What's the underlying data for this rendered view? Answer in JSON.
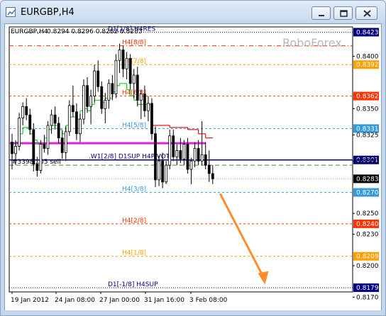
{
  "window": {
    "title": "EURGBP,H4",
    "controls": [
      "minimize-icon",
      "restore-icon",
      "close-icon"
    ]
  },
  "chart_data": {
    "type": "candlestick",
    "symbol_header": "EURGBP,H4",
    "ohlc_header": "0.8294 0.8296 0.8282 0.8283",
    "watermark": "RoboForex",
    "order_label": "#3398...05 sell",
    "ylim": [
      0.8175,
      0.8428
    ],
    "y_ticks": [
      "0.8400",
      "0.8350",
      "0.8325",
      "0.8300",
      "0.8250",
      "0.8230",
      "0.8200",
      "0.8170"
    ],
    "x_ticks": [
      "19 Jan 2012",
      "24 Jan 08:00",
      "27 Jan 00:00",
      "31 Jan 16:00",
      "3 Feb 08:00"
    ],
    "levels": [
      {
        "label": "D1[1/8] H4RES",
        "value": 0.8423,
        "price": "0.8423",
        "color": "#000080",
        "style": "dotted"
      },
      {
        "label": "H4[8/8]",
        "value": 0.841,
        "price": "",
        "color": "#ff2a00",
        "style": "dashdot"
      },
      {
        "label": "H4[7/8]",
        "value": 0.8392,
        "price": "0.8392",
        "color": "#ffa000",
        "style": "dashed"
      },
      {
        "label": "H4[6/8]",
        "value": 0.8362,
        "price": "0.8362",
        "color": "#ff3300",
        "style": "dashed"
      },
      {
        "label": "H4[5/8]",
        "value": 0.8331,
        "price": "0.8331",
        "color": "#3399dd",
        "style": "dashed"
      },
      {
        "label": ".W1[2/8] D1SUP H4PIVOT",
        "value": 0.8301,
        "price": "0.8301",
        "color": "#000080",
        "style": "solid"
      },
      {
        "label": "H4[3/8]",
        "value": 0.827,
        "price": "0.8270",
        "color": "#3399dd",
        "style": "dashed"
      },
      {
        "label": "H4[2/8]",
        "value": 0.824,
        "price": "0.8240",
        "color": "#ff3300",
        "style": "dashed"
      },
      {
        "label": "H4[1/8]",
        "value": 0.8209,
        "price": "0.8209",
        "color": "#ffa000",
        "style": "dashed"
      },
      {
        "label": "D1[-1/8] H4SUP",
        "value": 0.8179,
        "price": "0.8179",
        "color": "#000080",
        "style": "dotted"
      }
    ],
    "current_price": {
      "value": 0.8283,
      "price": "0.8283"
    },
    "order_line": {
      "value": 0.8296,
      "color": "#3a8a3a"
    },
    "magenta_line": {
      "value": 0.8317,
      "color": "#e020e0"
    },
    "candles": [
      [
        0.8318,
        0.8326,
        0.8292,
        0.8307
      ],
      [
        0.8307,
        0.832,
        0.8296,
        0.8314
      ],
      [
        0.8314,
        0.8346,
        0.831,
        0.8341
      ],
      [
        0.8341,
        0.8356,
        0.8334,
        0.8352
      ],
      [
        0.8352,
        0.836,
        0.8339,
        0.8344
      ],
      [
        0.8344,
        0.835,
        0.8325,
        0.833
      ],
      [
        0.833,
        0.8336,
        0.829,
        0.8297
      ],
      [
        0.8297,
        0.8304,
        0.8285,
        0.8291
      ],
      [
        0.8291,
        0.832,
        0.8288,
        0.8316
      ],
      [
        0.8316,
        0.8325,
        0.8308,
        0.8312
      ],
      [
        0.8312,
        0.8338,
        0.8306,
        0.8334
      ],
      [
        0.8334,
        0.8349,
        0.8326,
        0.8344
      ],
      [
        0.8344,
        0.8352,
        0.833,
        0.8336
      ],
      [
        0.8336,
        0.8342,
        0.8317,
        0.8322
      ],
      [
        0.8322,
        0.8329,
        0.8302,
        0.8308
      ],
      [
        0.8308,
        0.8333,
        0.83,
        0.8328
      ],
      [
        0.8328,
        0.8358,
        0.8324,
        0.8353
      ],
      [
        0.8353,
        0.8372,
        0.8342,
        0.8347
      ],
      [
        0.8347,
        0.8355,
        0.832,
        0.8326
      ],
      [
        0.8326,
        0.8345,
        0.8318,
        0.834
      ],
      [
        0.834,
        0.8378,
        0.8335,
        0.8372
      ],
      [
        0.8372,
        0.838,
        0.8346,
        0.8352
      ],
      [
        0.8352,
        0.8368,
        0.8335,
        0.8362
      ],
      [
        0.8362,
        0.8392,
        0.8356,
        0.8386
      ],
      [
        0.8386,
        0.8396,
        0.8366,
        0.8371
      ],
      [
        0.8371,
        0.8376,
        0.8345,
        0.835
      ],
      [
        0.835,
        0.8365,
        0.8336,
        0.8358
      ],
      [
        0.8358,
        0.8378,
        0.835,
        0.8374
      ],
      [
        0.8374,
        0.8382,
        0.8358,
        0.8364
      ],
      [
        0.8364,
        0.8402,
        0.836,
        0.8396
      ],
      [
        0.8396,
        0.8412,
        0.8384,
        0.8406
      ],
      [
        0.8406,
        0.841,
        0.838,
        0.8388
      ],
      [
        0.8388,
        0.8404,
        0.8378,
        0.8398
      ],
      [
        0.8398,
        0.8402,
        0.8368,
        0.8374
      ],
      [
        0.8374,
        0.8388,
        0.836,
        0.8382
      ],
      [
        0.8382,
        0.839,
        0.8352,
        0.8358
      ],
      [
        0.8358,
        0.8368,
        0.834,
        0.8364
      ],
      [
        0.8364,
        0.8372,
        0.8342,
        0.8348
      ],
      [
        0.8348,
        0.8362,
        0.8338,
        0.8355
      ],
      [
        0.8355,
        0.836,
        0.832,
        0.8326
      ],
      [
        0.8326,
        0.8333,
        0.8275,
        0.8282
      ],
      [
        0.8282,
        0.8305,
        0.8276,
        0.83
      ],
      [
        0.83,
        0.8308,
        0.8274,
        0.828
      ],
      [
        0.828,
        0.83,
        0.8278,
        0.8296
      ],
      [
        0.8296,
        0.833,
        0.8292,
        0.8324
      ],
      [
        0.8324,
        0.833,
        0.83,
        0.8304
      ],
      [
        0.8304,
        0.8316,
        0.8296,
        0.831
      ],
      [
        0.831,
        0.8322,
        0.8298,
        0.8302
      ],
      [
        0.8302,
        0.832,
        0.8296,
        0.8316
      ],
      [
        0.8316,
        0.8322,
        0.8288,
        0.8292
      ],
      [
        0.8292,
        0.8303,
        0.8278,
        0.83
      ],
      [
        0.83,
        0.8318,
        0.8294,
        0.8312
      ],
      [
        0.8312,
        0.832,
        0.8296,
        0.83
      ],
      [
        0.83,
        0.8338,
        0.8296,
        0.8306
      ],
      [
        0.8306,
        0.8318,
        0.8292,
        0.8296
      ],
      [
        0.8296,
        0.831,
        0.828,
        0.8288
      ],
      [
        0.8288,
        0.8296,
        0.8278,
        0.8283
      ]
    ],
    "stoploss_line": [
      0.8301,
      0.8308,
      0.8318,
      0.8326,
      0.8332,
      0.8332,
      0.8326,
      0.832,
      0.8316,
      0.8316,
      0.8322,
      0.833,
      0.8334,
      0.8334,
      0.833,
      0.8326,
      0.8334,
      0.8342,
      0.8342,
      0.834,
      0.8348,
      0.835,
      0.8348,
      0.8354,
      0.8358,
      0.8358,
      0.8356,
      0.836,
      0.836,
      0.8366,
      0.8372,
      0.8374,
      0.8374,
      0.8368,
      0.8362,
      0.8358,
      0.8354,
      0.8354,
      0.8354,
      0.8354,
      0.8334,
      0.8334,
      0.8334,
      0.8334,
      0.8334,
      0.8332,
      0.8332,
      0.8332,
      0.8332,
      0.8332,
      0.833,
      0.833,
      0.833,
      0.8326,
      0.8326,
      0.8322,
      0.8322
    ],
    "forecast_arrow": {
      "from": [
        57,
        0.8268
      ],
      "to": [
        69,
        0.8182
      ],
      "color": "#ff8c2a"
    }
  }
}
